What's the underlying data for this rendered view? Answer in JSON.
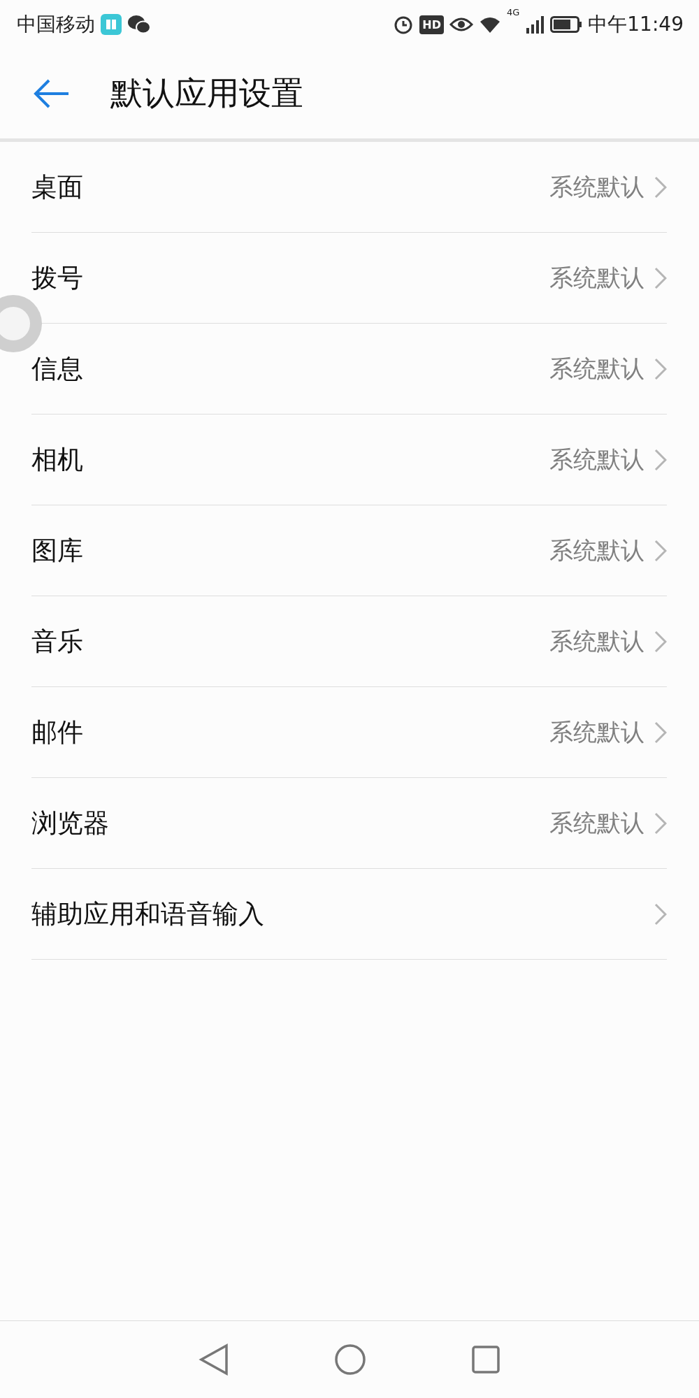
{
  "status_bar": {
    "carrier": "中国移动",
    "time": "中午11:49",
    "hd_badge": "HD",
    "network": "4G"
  },
  "header": {
    "title": "默认应用设置"
  },
  "items": [
    {
      "label": "桌面",
      "value": "系统默认"
    },
    {
      "label": "拨号",
      "value": "系统默认"
    },
    {
      "label": "信息",
      "value": "系统默认"
    },
    {
      "label": "相机",
      "value": "系统默认"
    },
    {
      "label": "图库",
      "value": "系统默认"
    },
    {
      "label": "音乐",
      "value": "系统默认"
    },
    {
      "label": "邮件",
      "value": "系统默认"
    },
    {
      "label": "浏览器",
      "value": "系统默认"
    },
    {
      "label": "辅助应用和语音输入"
    }
  ]
}
